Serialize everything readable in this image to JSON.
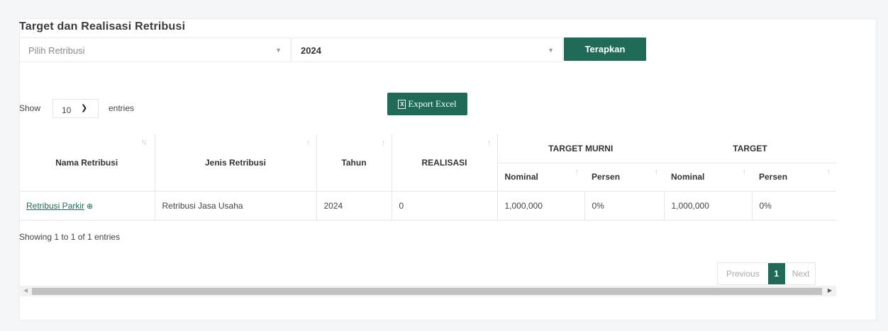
{
  "title": "Target dan Realisasi Retribusi",
  "filters": {
    "retribusi_placeholder": "Pilih Retribusi",
    "tahun_value": "2024",
    "apply_label": "Terapkan"
  },
  "length": {
    "show_label": "Show",
    "value": "10",
    "entries_label": "entries"
  },
  "export_label": "Export Excel",
  "table": {
    "headers": {
      "nama": "Nama Retribusi",
      "jenis": "Jenis Retribusi",
      "tahun": "Tahun",
      "realisasi": "REALISASI",
      "target_murni": "TARGET MURNI",
      "target": "TARGET",
      "nominal": "Nominal",
      "persen": "Persen"
    },
    "rows": [
      {
        "nama": "Retribusi Parkir",
        "jenis": "Retribusi Jasa Usaha",
        "tahun": "2024",
        "realisasi": "0",
        "tm_nominal": "1,000,000",
        "tm_persen": "0%",
        "t_nominal": "1,000,000",
        "t_persen": "0%"
      }
    ]
  },
  "info": "Showing 1 to 1 of 1 entries",
  "pagination": {
    "previous": "Previous",
    "current": "1",
    "next": "Next"
  },
  "colors": {
    "primary": "#1f6b57",
    "background": "#f4f5f7"
  }
}
